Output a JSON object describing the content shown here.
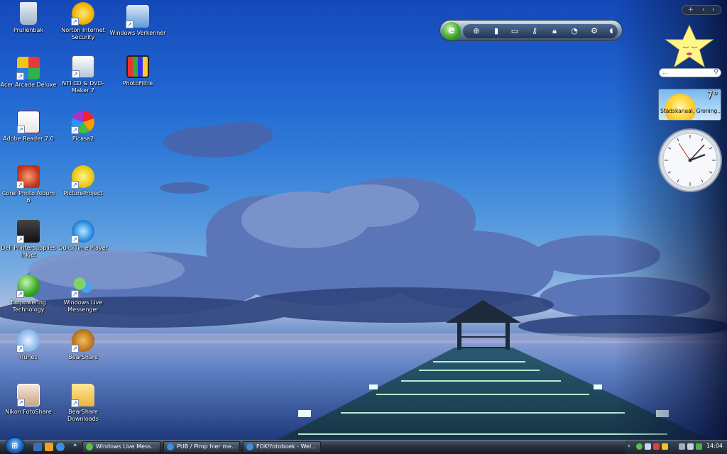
{
  "desktop": {
    "icons": [
      {
        "label": "Prullenbak",
        "icon": "recycle-bin-icon"
      },
      {
        "label": "Norton Internet Security",
        "icon": "norton-icon"
      },
      {
        "label": "Windows Verkenner",
        "icon": "explorer-icon"
      },
      {
        "label": "Acer Arcade Deluxe",
        "icon": "acer-arcade-icon"
      },
      {
        "label": "NTI CD & DVD-Maker 7",
        "icon": "nti-icon"
      },
      {
        "label": "PhotoFiltre",
        "icon": "photofiltre-icon"
      },
      {
        "label": "Adobe Reader 7.0",
        "icon": "adobe-reader-icon"
      },
      {
        "label": "Picasa2",
        "icon": "picasa-icon"
      },
      {
        "label": "Corel Photo Album 6",
        "icon": "corel-icon"
      },
      {
        "label": "PictureProject",
        "icon": "pictureproject-icon"
      },
      {
        "label": "Dell Printersupplies Inkjet",
        "icon": "dell-printer-icon"
      },
      {
        "label": "QuickTime Player",
        "icon": "quicktime-icon"
      },
      {
        "label": "Empowering Technology",
        "icon": "empowering-icon"
      },
      {
        "label": "Windows Live Messenger",
        "icon": "messenger-icon"
      },
      {
        "label": "iTunes",
        "icon": "itunes-icon"
      },
      {
        "label": "BearShare",
        "icon": "bearshare-icon"
      },
      {
        "label": "Nikon FotoShare",
        "icon": "nikon-icon"
      },
      {
        "label": "BearShare Downloads",
        "icon": "folder-icon"
      }
    ]
  },
  "taskbar": {
    "tasks": [
      {
        "label": "Windows Live Mess..."
      },
      {
        "label": "PUB / Pimp hier me..."
      },
      {
        "label": "FOK!fotoboek - Wel..."
      }
    ],
    "clock": "14:04",
    "overflow_chevron": "»"
  },
  "sidebar": {
    "controls": {
      "add": "+",
      "prev": "‹",
      "next": "›"
    },
    "search_placeholder": "...",
    "weather": {
      "temperature": "7°",
      "location": "Stadskanaal, Groning..."
    }
  },
  "gadget_toolbar": {
    "logo": "e"
  },
  "colors": {
    "wallpaper_sky": "#1f62cf",
    "taskbar": "#151b22",
    "accent_green": "#3cab2c"
  }
}
